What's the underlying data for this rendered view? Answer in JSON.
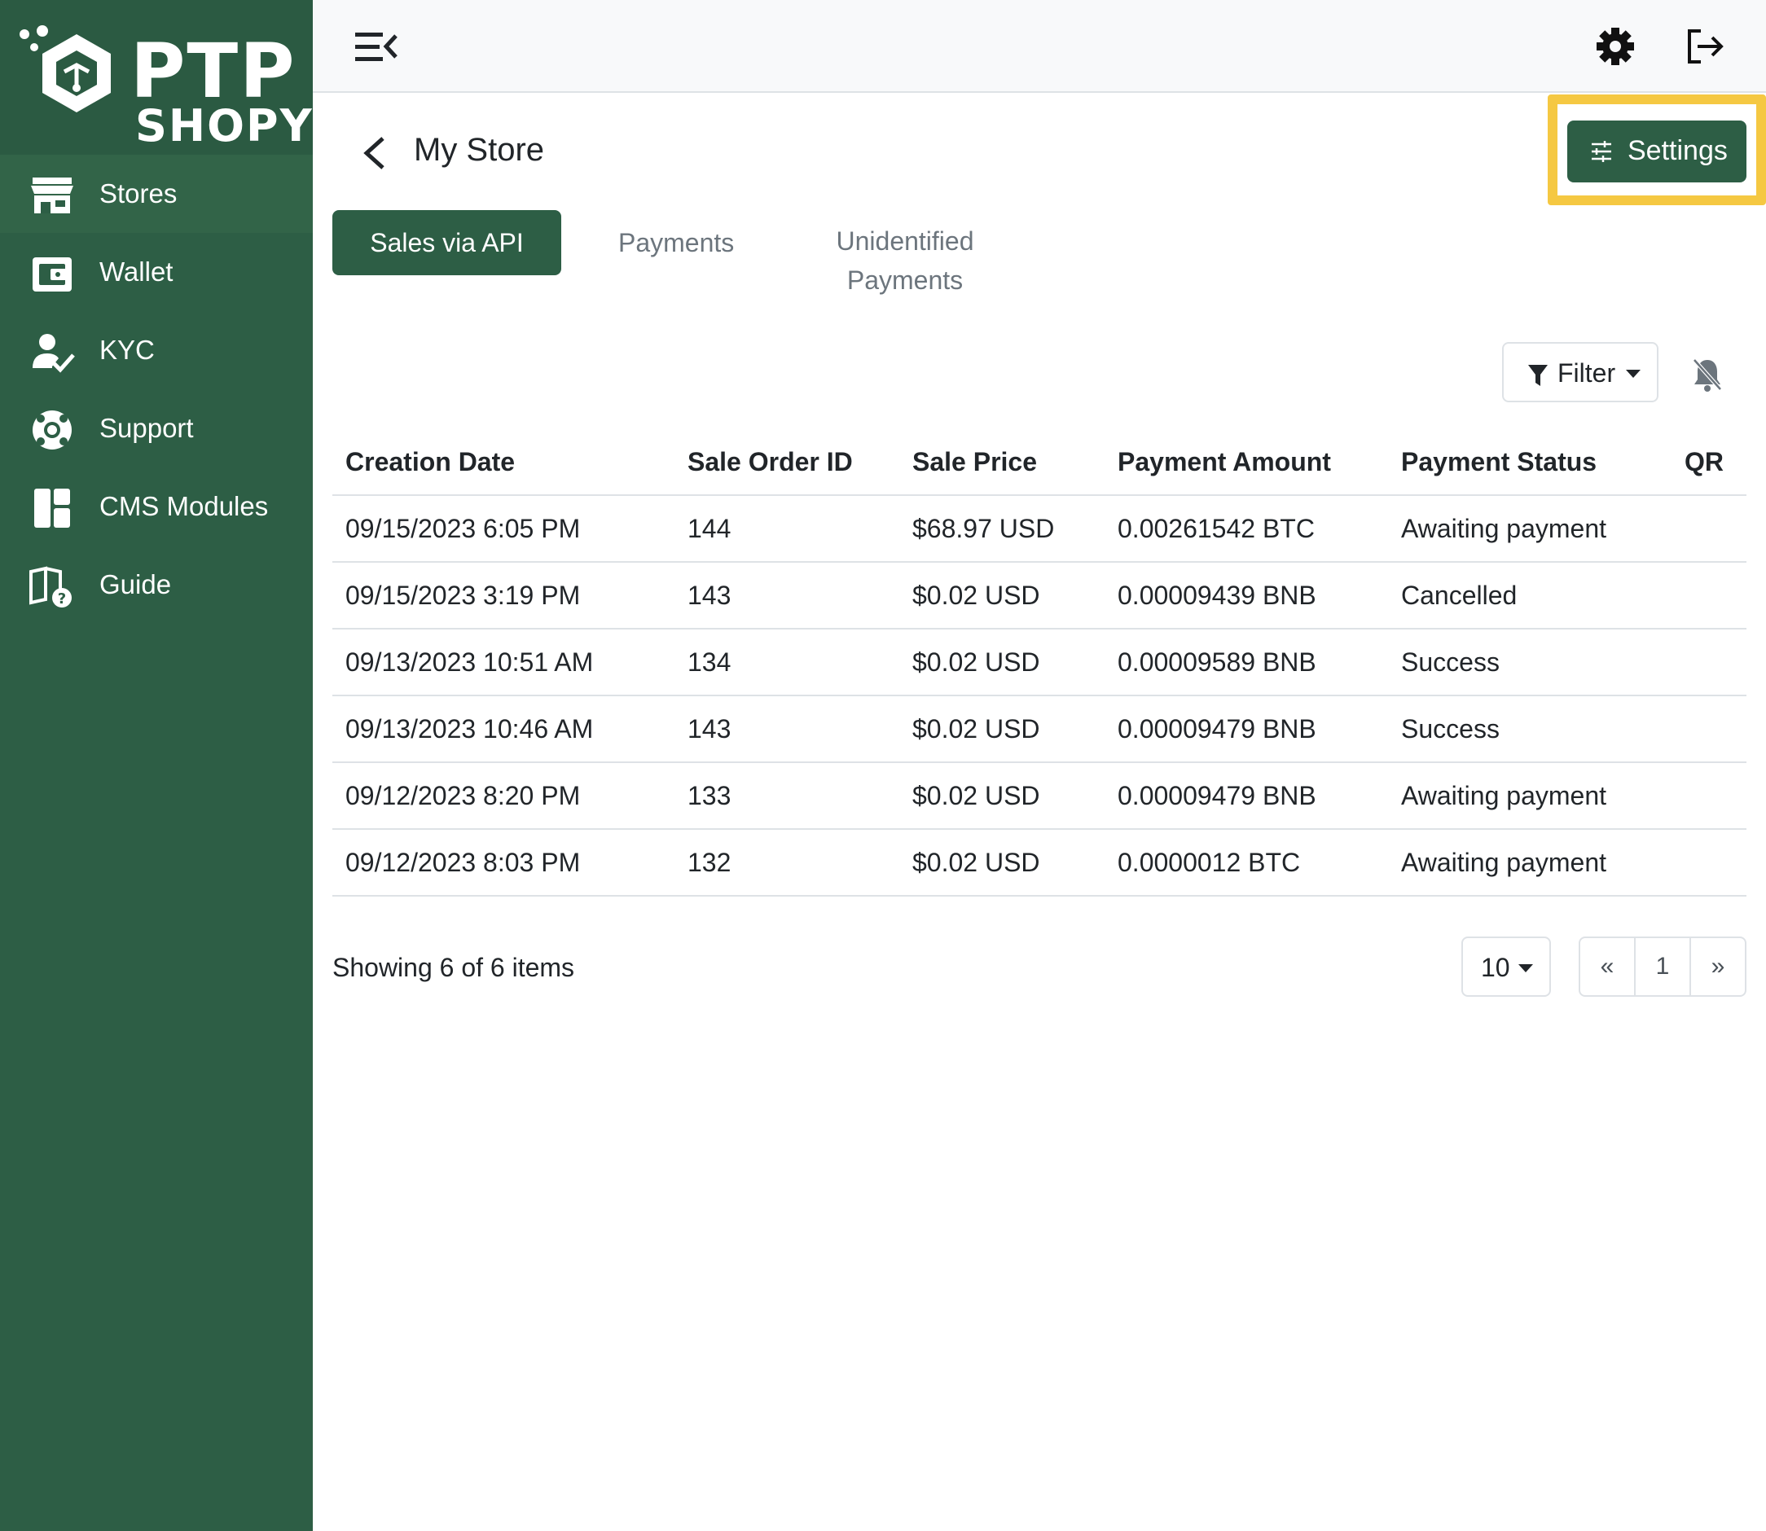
{
  "brand": {
    "line1": "PTP",
    "line2": "SHOPY"
  },
  "sidebar": {
    "items": [
      {
        "label": "Stores",
        "icon": "store-icon"
      },
      {
        "label": "Wallet",
        "icon": "wallet-icon"
      },
      {
        "label": "KYC",
        "icon": "user-check-icon"
      },
      {
        "label": "Support",
        "icon": "lifebuoy-icon"
      },
      {
        "label": "CMS Modules",
        "icon": "layout-icon"
      },
      {
        "label": "Guide",
        "icon": "book-question-icon"
      }
    ]
  },
  "header": {
    "title": "My Store",
    "settings_label": "Settings"
  },
  "tabs": {
    "sales": "Sales via API",
    "payments": "Payments",
    "unidentified_1": "Unidentified",
    "unidentified_2": "Payments"
  },
  "filter": {
    "label": "Filter"
  },
  "table": {
    "headers": [
      "Creation Date",
      "Sale Order ID",
      "Sale Price",
      "Payment Amount",
      "Payment Status",
      "QR"
    ],
    "rows": [
      [
        "09/15/2023 6:05 PM",
        "144",
        "$68.97 USD",
        "0.00261542 BTC",
        "Awaiting payment",
        ""
      ],
      [
        "09/15/2023 3:19 PM",
        "143",
        "$0.02 USD",
        "0.00009439 BNB",
        "Cancelled",
        ""
      ],
      [
        "09/13/2023 10:51 AM",
        "134",
        "$0.02 USD",
        "0.00009589 BNB",
        "Success",
        ""
      ],
      [
        "09/13/2023 10:46 AM",
        "143",
        "$0.02 USD",
        "0.00009479 BNB",
        "Success",
        ""
      ],
      [
        "09/12/2023 8:20 PM",
        "133",
        "$0.02 USD",
        "0.00009479 BNB",
        "Awaiting payment",
        ""
      ],
      [
        "09/12/2023 8:03 PM",
        "132",
        "$0.02 USD",
        "0.0000012 BTC",
        "Awaiting payment",
        ""
      ]
    ]
  },
  "footer": {
    "showing": "Showing 6 of 6 items",
    "page_size": "10",
    "prev": "«",
    "page": "1",
    "next": "»"
  },
  "colors": {
    "sidebar": "#2d5e45",
    "accent": "#2d5e45",
    "highlight": "#f5c842"
  }
}
